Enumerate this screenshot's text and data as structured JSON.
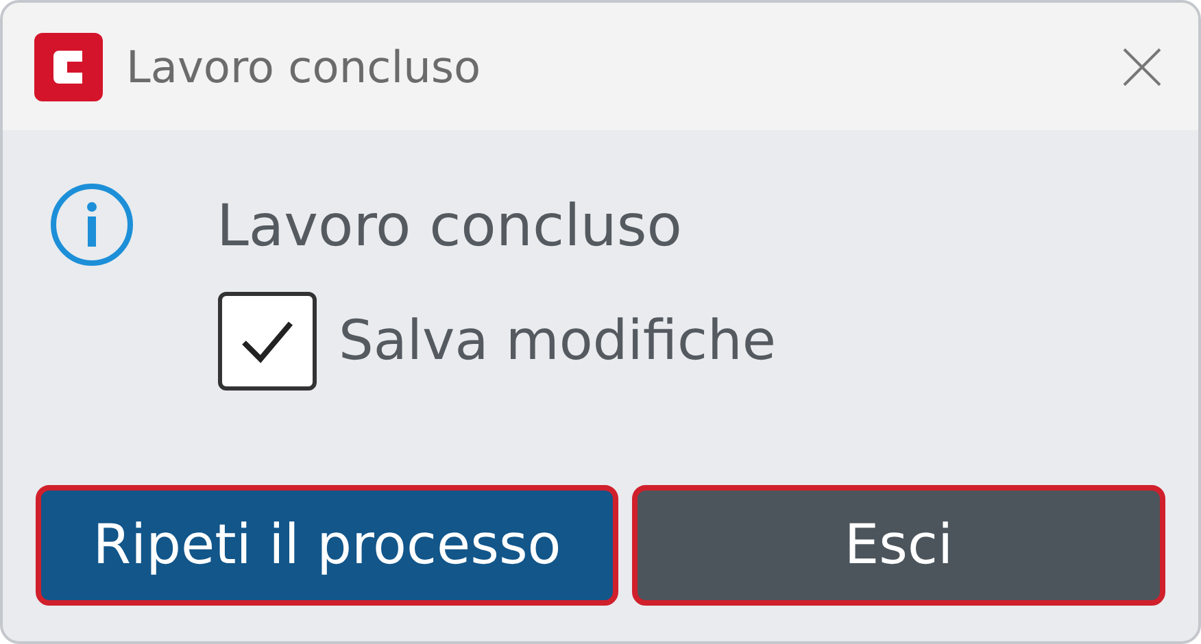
{
  "window": {
    "title": "Lavoro concluso"
  },
  "message": "Lavoro concluso",
  "checkbox": {
    "label": "Salva modifiche",
    "checked": true
  },
  "buttons": [
    {
      "label": "Ripeti il processo",
      "kind": "primary"
    },
    {
      "label": "Esci",
      "kind": "secondary"
    }
  ]
}
